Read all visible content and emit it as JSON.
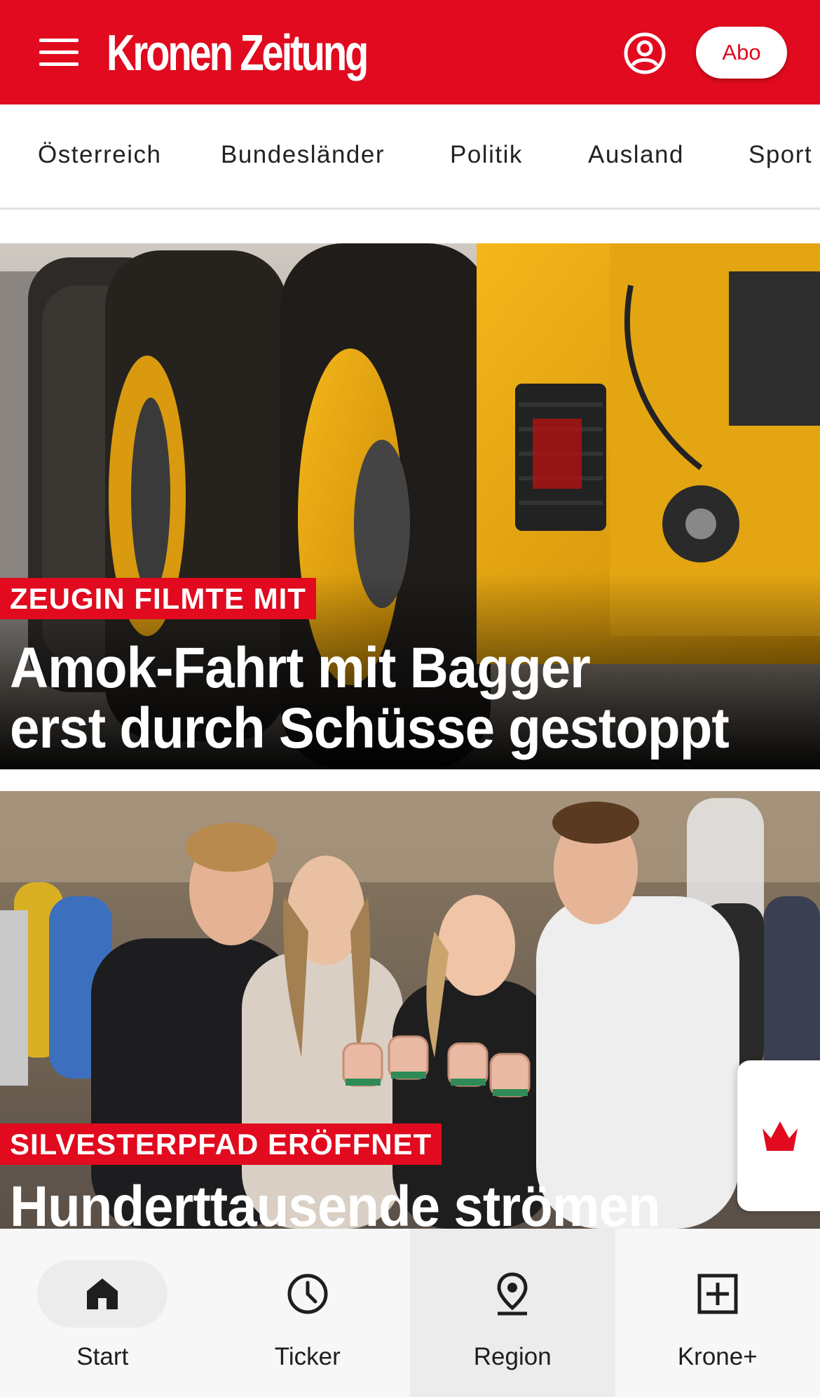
{
  "header": {
    "logo_text": "Kronen Zeitung",
    "abo_label": "Abo",
    "brand_color": "#e10a1e"
  },
  "categories": [
    "Österreich",
    "Bundesländer",
    "Politik",
    "Ausland",
    "Sport"
  ],
  "articles": [
    {
      "kicker": "ZEUGIN FILMTE MIT",
      "headline": "Amok-Fahrt mit Bagger\nerst durch Schüsse gestoppt",
      "image": "yellow excavator wheels"
    },
    {
      "kicker": "SILVESTERPFAD ERÖFFNET",
      "headline": "Hunderttausende strömen",
      "image": "four people toasting with mugs at a street market"
    }
  ],
  "bottom_nav": [
    {
      "label": "Start",
      "icon": "home-icon",
      "active": true
    },
    {
      "label": "Ticker",
      "icon": "clock-icon",
      "active": false
    },
    {
      "label": "Region",
      "icon": "location-pin-icon",
      "active": false
    },
    {
      "label": "Krone+",
      "icon": "plus-box-icon",
      "active": false
    }
  ]
}
